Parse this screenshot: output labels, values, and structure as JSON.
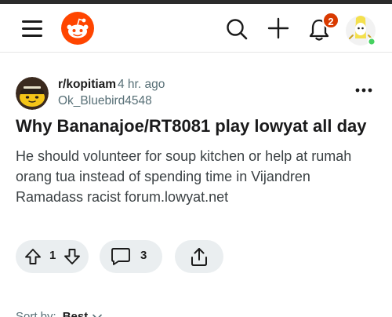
{
  "header": {
    "menu_icon": "hamburger-menu-icon",
    "logo_icon": "reddit-logo-icon",
    "search_icon": "search-icon",
    "create_icon": "plus-icon",
    "notifications_icon": "bell-icon",
    "notification_count": "2",
    "brand_color": "#ff4500",
    "badge_color": "#d93a00"
  },
  "post": {
    "subreddit": "r/kopitiam",
    "age": "4 hr. ago",
    "author": "Ok_Bluebird4548",
    "title": "Why Bananajoe/RT8081 play lowyat all day",
    "body": "He should volunteer for soup kitchen or help at rumah orang tua instead of spending time in Vijandren Ramadass racist forum.lowyat.net",
    "score": "1",
    "comments": "3"
  },
  "actions": {
    "upvote_icon": "upvote-arrow-icon",
    "downvote_icon": "downvote-arrow-icon",
    "comment_icon": "comment-bubble-icon",
    "share_icon": "share-icon"
  },
  "sort": {
    "label": "Sort by:",
    "value": "Best"
  }
}
